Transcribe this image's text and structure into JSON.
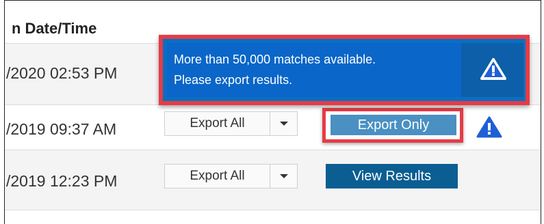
{
  "table": {
    "column_header": "n Date/Time",
    "rows": [
      {
        "date": "/2020 02:53 PM"
      },
      {
        "date": "/2019 09:37 AM",
        "export_all_label": "Export All",
        "action_label": "Export Only",
        "has_warning": true
      },
      {
        "date": "/2019 12:23 PM",
        "export_all_label": "Export All",
        "action_label": "View Results",
        "has_warning": false
      }
    ]
  },
  "banner": {
    "line1": "More than 50,000 matches available.",
    "line2": "Please export results.",
    "icon": "warning-triangle-icon"
  },
  "colors": {
    "highlight": "#e53c45",
    "banner_bg": "#0a66c8",
    "view_results_bg": "#0a5e92",
    "export_only_bg": "#4a90c2",
    "warning_icon": "#1f5fd6"
  }
}
